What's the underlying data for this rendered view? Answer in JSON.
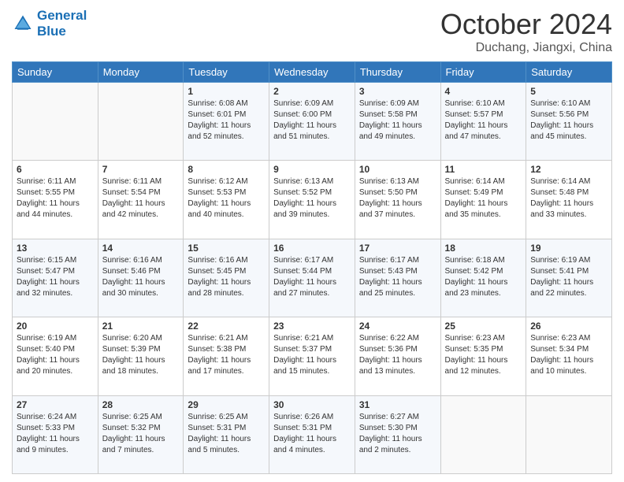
{
  "logo": {
    "line1": "General",
    "line2": "Blue"
  },
  "title": "October 2024",
  "location": "Duchang, Jiangxi, China",
  "days_header": [
    "Sunday",
    "Monday",
    "Tuesday",
    "Wednesday",
    "Thursday",
    "Friday",
    "Saturday"
  ],
  "weeks": [
    [
      {
        "day": "",
        "info": ""
      },
      {
        "day": "",
        "info": ""
      },
      {
        "day": "1",
        "info": "Sunrise: 6:08 AM\nSunset: 6:01 PM\nDaylight: 11 hours and 52 minutes."
      },
      {
        "day": "2",
        "info": "Sunrise: 6:09 AM\nSunset: 6:00 PM\nDaylight: 11 hours and 51 minutes."
      },
      {
        "day": "3",
        "info": "Sunrise: 6:09 AM\nSunset: 5:58 PM\nDaylight: 11 hours and 49 minutes."
      },
      {
        "day": "4",
        "info": "Sunrise: 6:10 AM\nSunset: 5:57 PM\nDaylight: 11 hours and 47 minutes."
      },
      {
        "day": "5",
        "info": "Sunrise: 6:10 AM\nSunset: 5:56 PM\nDaylight: 11 hours and 45 minutes."
      }
    ],
    [
      {
        "day": "6",
        "info": "Sunrise: 6:11 AM\nSunset: 5:55 PM\nDaylight: 11 hours and 44 minutes."
      },
      {
        "day": "7",
        "info": "Sunrise: 6:11 AM\nSunset: 5:54 PM\nDaylight: 11 hours and 42 minutes."
      },
      {
        "day": "8",
        "info": "Sunrise: 6:12 AM\nSunset: 5:53 PM\nDaylight: 11 hours and 40 minutes."
      },
      {
        "day": "9",
        "info": "Sunrise: 6:13 AM\nSunset: 5:52 PM\nDaylight: 11 hours and 39 minutes."
      },
      {
        "day": "10",
        "info": "Sunrise: 6:13 AM\nSunset: 5:50 PM\nDaylight: 11 hours and 37 minutes."
      },
      {
        "day": "11",
        "info": "Sunrise: 6:14 AM\nSunset: 5:49 PM\nDaylight: 11 hours and 35 minutes."
      },
      {
        "day": "12",
        "info": "Sunrise: 6:14 AM\nSunset: 5:48 PM\nDaylight: 11 hours and 33 minutes."
      }
    ],
    [
      {
        "day": "13",
        "info": "Sunrise: 6:15 AM\nSunset: 5:47 PM\nDaylight: 11 hours and 32 minutes."
      },
      {
        "day": "14",
        "info": "Sunrise: 6:16 AM\nSunset: 5:46 PM\nDaylight: 11 hours and 30 minutes."
      },
      {
        "day": "15",
        "info": "Sunrise: 6:16 AM\nSunset: 5:45 PM\nDaylight: 11 hours and 28 minutes."
      },
      {
        "day": "16",
        "info": "Sunrise: 6:17 AM\nSunset: 5:44 PM\nDaylight: 11 hours and 27 minutes."
      },
      {
        "day": "17",
        "info": "Sunrise: 6:17 AM\nSunset: 5:43 PM\nDaylight: 11 hours and 25 minutes."
      },
      {
        "day": "18",
        "info": "Sunrise: 6:18 AM\nSunset: 5:42 PM\nDaylight: 11 hours and 23 minutes."
      },
      {
        "day": "19",
        "info": "Sunrise: 6:19 AM\nSunset: 5:41 PM\nDaylight: 11 hours and 22 minutes."
      }
    ],
    [
      {
        "day": "20",
        "info": "Sunrise: 6:19 AM\nSunset: 5:40 PM\nDaylight: 11 hours and 20 minutes."
      },
      {
        "day": "21",
        "info": "Sunrise: 6:20 AM\nSunset: 5:39 PM\nDaylight: 11 hours and 18 minutes."
      },
      {
        "day": "22",
        "info": "Sunrise: 6:21 AM\nSunset: 5:38 PM\nDaylight: 11 hours and 17 minutes."
      },
      {
        "day": "23",
        "info": "Sunrise: 6:21 AM\nSunset: 5:37 PM\nDaylight: 11 hours and 15 minutes."
      },
      {
        "day": "24",
        "info": "Sunrise: 6:22 AM\nSunset: 5:36 PM\nDaylight: 11 hours and 13 minutes."
      },
      {
        "day": "25",
        "info": "Sunrise: 6:23 AM\nSunset: 5:35 PM\nDaylight: 11 hours and 12 minutes."
      },
      {
        "day": "26",
        "info": "Sunrise: 6:23 AM\nSunset: 5:34 PM\nDaylight: 11 hours and 10 minutes."
      }
    ],
    [
      {
        "day": "27",
        "info": "Sunrise: 6:24 AM\nSunset: 5:33 PM\nDaylight: 11 hours and 9 minutes."
      },
      {
        "day": "28",
        "info": "Sunrise: 6:25 AM\nSunset: 5:32 PM\nDaylight: 11 hours and 7 minutes."
      },
      {
        "day": "29",
        "info": "Sunrise: 6:25 AM\nSunset: 5:31 PM\nDaylight: 11 hours and 5 minutes."
      },
      {
        "day": "30",
        "info": "Sunrise: 6:26 AM\nSunset: 5:31 PM\nDaylight: 11 hours and 4 minutes."
      },
      {
        "day": "31",
        "info": "Sunrise: 6:27 AM\nSunset: 5:30 PM\nDaylight: 11 hours and 2 minutes."
      },
      {
        "day": "",
        "info": ""
      },
      {
        "day": "",
        "info": ""
      }
    ]
  ]
}
